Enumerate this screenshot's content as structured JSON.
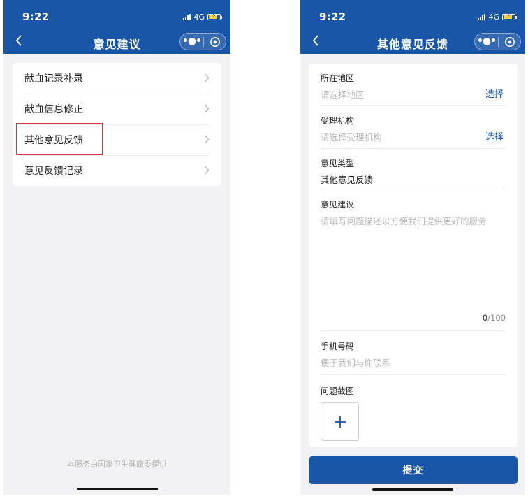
{
  "colors": {
    "brand": "#1a56a8",
    "highlight": "#d9363e",
    "background": "#f2f2f4"
  },
  "status_bar": {
    "time": "9:22",
    "network": "4G"
  },
  "left_screen": {
    "nav_title": "意见建议",
    "menu_items": [
      {
        "label": "献血记录补录",
        "icon": "chevron-right-icon"
      },
      {
        "label": "献血信息修正",
        "icon": "chevron-right-icon"
      },
      {
        "label": "其他意见反馈",
        "icon": "chevron-right-icon"
      },
      {
        "label": "意见反馈记录",
        "icon": "chevron-right-icon"
      }
    ],
    "highlighted_item": "其他意见反馈",
    "footer": "本服务由国家卫生健康委提供"
  },
  "right_screen": {
    "nav_title": "其他意见反馈",
    "fields": {
      "region": {
        "label": "所在地区",
        "placeholder": "请选择地区",
        "action": "选择"
      },
      "agency": {
        "label": "受理机构",
        "placeholder": "请选择受理机构",
        "action": "选择"
      },
      "type": {
        "label": "意见类型",
        "value": "其他意见反馈"
      },
      "suggestion": {
        "label": "意见建议",
        "placeholder": "请填写问题描述以方便我们提供更好的服务",
        "count": "0",
        "max": "/100"
      },
      "phone": {
        "label": "手机号码",
        "placeholder": "便于我们与你联系"
      },
      "screenshot": {
        "label": "问题截图",
        "icon": "plus-icon"
      }
    },
    "submit_label": "提交"
  }
}
